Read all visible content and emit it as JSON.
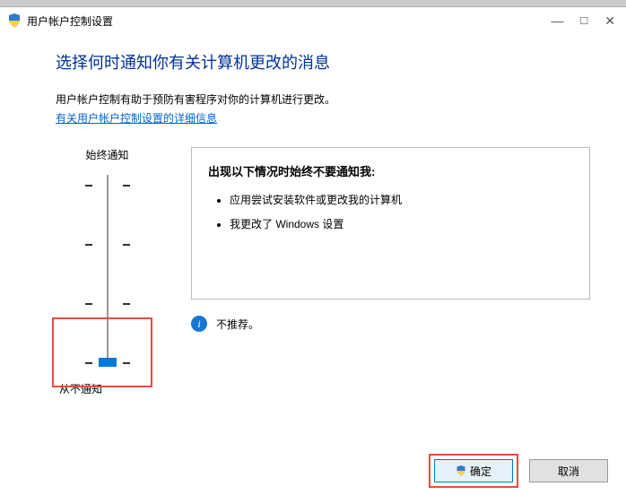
{
  "titlebar": {
    "title": "用户帐户控制设置"
  },
  "content": {
    "heading": "选择何时通知你有关计算机更改的消息",
    "desc": "用户帐户控制有助于预防有害程序对你的计算机进行更改。",
    "link": "有关用户帐户控制设置的详细信息"
  },
  "slider": {
    "label_top": "始终通知",
    "label_bottom": "从不通知",
    "levels": 4,
    "selected_level": 0
  },
  "info": {
    "title": "出现以下情况时始终不要通知我:",
    "items": [
      "应用尝试安装软件或更改我的计算机",
      "我更改了 Windows 设置"
    ],
    "recommend": "不推荐。"
  },
  "buttons": {
    "ok": "确定",
    "cancel": "取消"
  }
}
